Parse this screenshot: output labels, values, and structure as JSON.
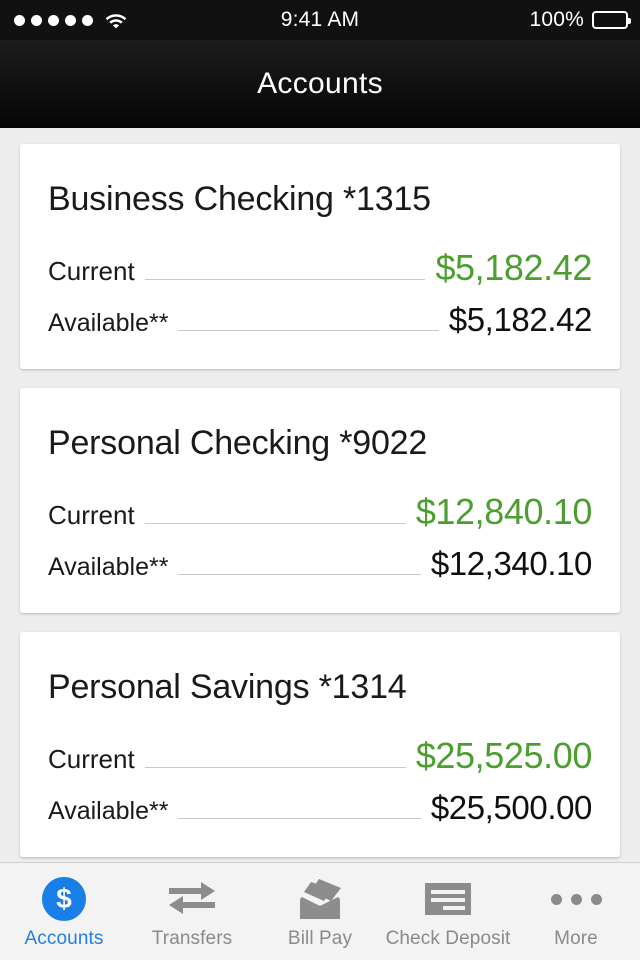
{
  "status_bar": {
    "signal_dots": 5,
    "wifi_icon": "wifi-icon",
    "time": "9:41 AM",
    "battery_percent": "100%",
    "battery_icon": "battery-full-icon"
  },
  "header": {
    "title": "Accounts"
  },
  "colors": {
    "accent_blue": "#1a7ee8",
    "positive_green": "#4d9e30",
    "page_background": "#ededed",
    "card_background": "#ffffff",
    "header_background": "#121212",
    "muted_gray": "#8a8a8a"
  },
  "accounts": [
    {
      "title": "Business Checking *1315",
      "current_label": "Current",
      "current_value": "$5,182.42",
      "available_label": "Available**",
      "available_value": "$5,182.42"
    },
    {
      "title": "Personal Checking *9022",
      "current_label": "Current",
      "current_value": "$12,840.10",
      "available_label": "Available**",
      "available_value": "$12,340.10"
    },
    {
      "title": "Personal Savings *1314",
      "current_label": "Current",
      "current_value": "$25,525.00",
      "available_label": "Available**",
      "available_value": "$25,500.00"
    }
  ],
  "tab_bar": {
    "items": [
      {
        "label": "Accounts",
        "icon": "dollar-circle-icon",
        "active": true
      },
      {
        "label": "Transfers",
        "icon": "transfer-arrows-icon",
        "active": false
      },
      {
        "label": "Bill Pay",
        "icon": "envelope-icon",
        "active": false
      },
      {
        "label": "Check Deposit",
        "icon": "check-icon",
        "active": false
      },
      {
        "label": "More",
        "icon": "ellipsis-icon",
        "active": false
      }
    ]
  }
}
